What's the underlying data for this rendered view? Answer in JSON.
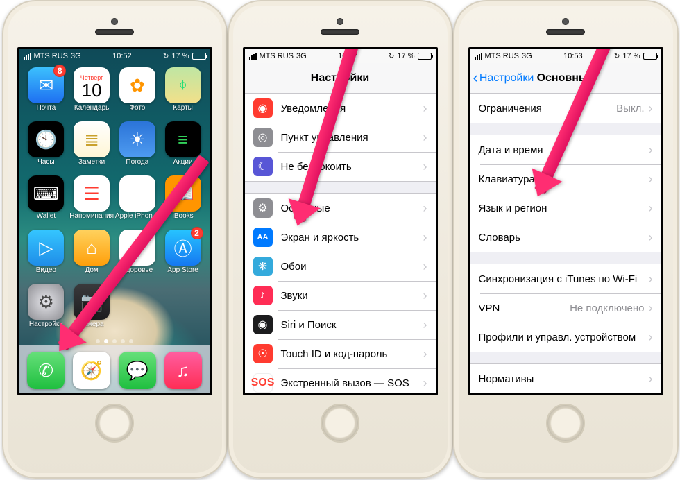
{
  "status": {
    "carrier": "MTS RUS",
    "network": "3G",
    "battery_pct": "17 %",
    "sync_glyph": "↻"
  },
  "times": {
    "p1": "10:52",
    "p2": "10:52",
    "p3": "10:53"
  },
  "home": {
    "apps": [
      {
        "name": "mail",
        "label": "Почта",
        "glyph": "✉︎",
        "bg": "linear-gradient(#3cc0fd,#1e6ff1)",
        "badge": "8"
      },
      {
        "name": "calendar",
        "label": "Календарь",
        "dow": "Четверг",
        "dom": "10"
      },
      {
        "name": "photos",
        "label": "Фото",
        "glyph": "✿",
        "bg": "#fff",
        "fg": "#ff9500"
      },
      {
        "name": "maps",
        "label": "Карты",
        "glyph": "⌖",
        "bg": "linear-gradient(#bfe6a3,#f2e08a)",
        "fg": "#2d7"
      },
      {
        "name": "clock",
        "label": "Часы",
        "glyph": "🕙",
        "bg": "#000"
      },
      {
        "name": "notes",
        "label": "Заметки",
        "glyph": "≣",
        "bg": "linear-gradient(#fff,#fff6d5)",
        "fg": "#c9a12c"
      },
      {
        "name": "weather",
        "label": "Погода",
        "glyph": "☀︎",
        "bg": "linear-gradient(#2b74d8,#4e9bf0)"
      },
      {
        "name": "stocks",
        "label": "Акции",
        "glyph": "≡",
        "bg": "#000",
        "fg": "#32d15a"
      },
      {
        "name": "wallet",
        "label": "Wallet",
        "glyph": "⌨︎",
        "bg": "#000"
      },
      {
        "name": "reminders",
        "label": "Напоминания",
        "glyph": "☰",
        "bg": "#fff",
        "fg": "#ff3b30"
      },
      {
        "name": "apple",
        "label": "Apple iPhon…",
        "glyph": "",
        "bg": "#fff",
        "fg": "#444"
      },
      {
        "name": "ibooks",
        "label": "iBooks",
        "glyph": "📖",
        "bg": "#ff9500"
      },
      {
        "name": "videos",
        "label": "Видео",
        "glyph": "▷",
        "bg": "linear-gradient(#35c6ff,#1f8de8)"
      },
      {
        "name": "home2",
        "label": "Дом",
        "glyph": "⌂",
        "bg": "linear-gradient(#ffd25e,#ff9f0a)"
      },
      {
        "name": "health",
        "label": "Здоровье",
        "glyph": "♥︎",
        "bg": "#fff",
        "fg": "#ff2d55"
      },
      {
        "name": "appstore",
        "label": "App Store",
        "glyph": "Ⓐ",
        "bg": "linear-gradient(#27c4ff,#1578f1)",
        "badge": "2"
      },
      {
        "name": "settings",
        "label": "Настройки",
        "glyph": "⚙︎",
        "bg": "radial-gradient(circle,#e5e5ea,#8e8e93)",
        "fg": "#4a4a4a"
      },
      {
        "name": "camera",
        "label": "Камера",
        "glyph": "📷",
        "bg": "linear-gradient(#3a3a3c,#1c1c1e)"
      }
    ],
    "dock": [
      {
        "name": "phone",
        "glyph": "✆",
        "bg": "linear-gradient(#66e07a,#1fbf3f)"
      },
      {
        "name": "safari",
        "glyph": "🧭",
        "bg": "#fff",
        "fg": "#1e88ff"
      },
      {
        "name": "messages",
        "glyph": "💬",
        "bg": "linear-gradient(#66e07a,#1fbf3f)"
      },
      {
        "name": "music",
        "glyph": "♫",
        "bg": "linear-gradient(#ff5ea0,#ff2d55)"
      }
    ]
  },
  "settings": {
    "title": "Настройки",
    "rows1": [
      {
        "icon_bg": "bg-red",
        "glyph": "◉",
        "label": "Уведомления"
      },
      {
        "icon_bg": "bg-grey",
        "glyph": "◎",
        "label": "Пункт управления"
      },
      {
        "icon_bg": "bg-purple",
        "glyph": "☾",
        "label": "Не беспокоить"
      }
    ],
    "rows2": [
      {
        "icon_bg": "bg-grey",
        "glyph": "⚙︎",
        "label": "Основные"
      },
      {
        "icon_bg": "bg-blue",
        "glyph": "AA",
        "label": "Экран и яркость",
        "small": true
      },
      {
        "icon_bg": "bg-cyan",
        "glyph": "❋",
        "label": "Обои"
      },
      {
        "icon_bg": "bg-pink",
        "glyph": "♪",
        "label": "Звуки"
      },
      {
        "icon_bg": "bg-black",
        "glyph": "◉",
        "label": "Siri и Поиск"
      },
      {
        "icon_bg": "bg-red",
        "glyph": "☉",
        "label": "Touch ID и код-пароль"
      },
      {
        "icon_bg": "bg-sos",
        "glyph": "SOS",
        "label": "Экстренный вызов — SOS"
      }
    ]
  },
  "general": {
    "back": "Настройки",
    "title": "Основные",
    "g1": [
      {
        "label": "Ограничения",
        "detail": "Выкл."
      }
    ],
    "g2": [
      {
        "label": "Дата и время"
      },
      {
        "label": "Клавиатура"
      },
      {
        "label": "Язык и регион"
      },
      {
        "label": "Словарь"
      }
    ],
    "g3": [
      {
        "label": "Синхронизация с iTunes по Wi-Fi"
      },
      {
        "label": "VPN",
        "detail": "Не подключено"
      },
      {
        "label": "Профили и управл. устройством"
      }
    ],
    "g4": [
      {
        "label": "Нормативы"
      }
    ]
  }
}
